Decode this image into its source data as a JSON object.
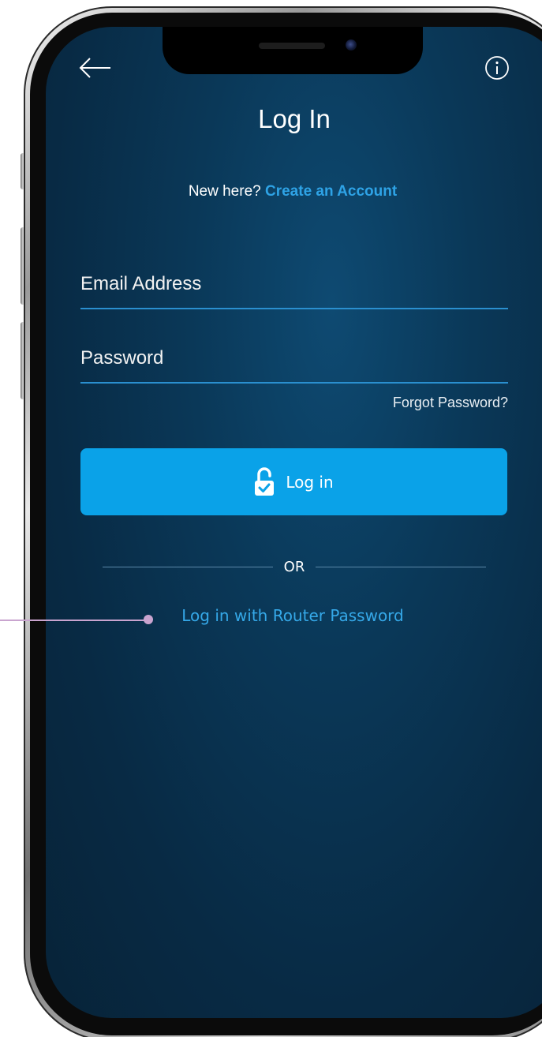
{
  "screen": {
    "title": "Log In",
    "signup_prompt": "New here?",
    "signup_link": "Create an Account",
    "email_placeholder": "Email Address",
    "password_placeholder": "Password",
    "forgot_password": "Forgot Password?",
    "login_button": "Log in",
    "divider_text": "OR",
    "router_login_link": "Log in with Router Password"
  },
  "icons": {
    "back": "arrow-left-icon",
    "info": "info-icon",
    "login": "unlock-icon"
  },
  "colors": {
    "background": "#0a3858",
    "accent": "#0aa2e8",
    "link": "#35a8e8",
    "annotation": "#c9a4cf"
  }
}
